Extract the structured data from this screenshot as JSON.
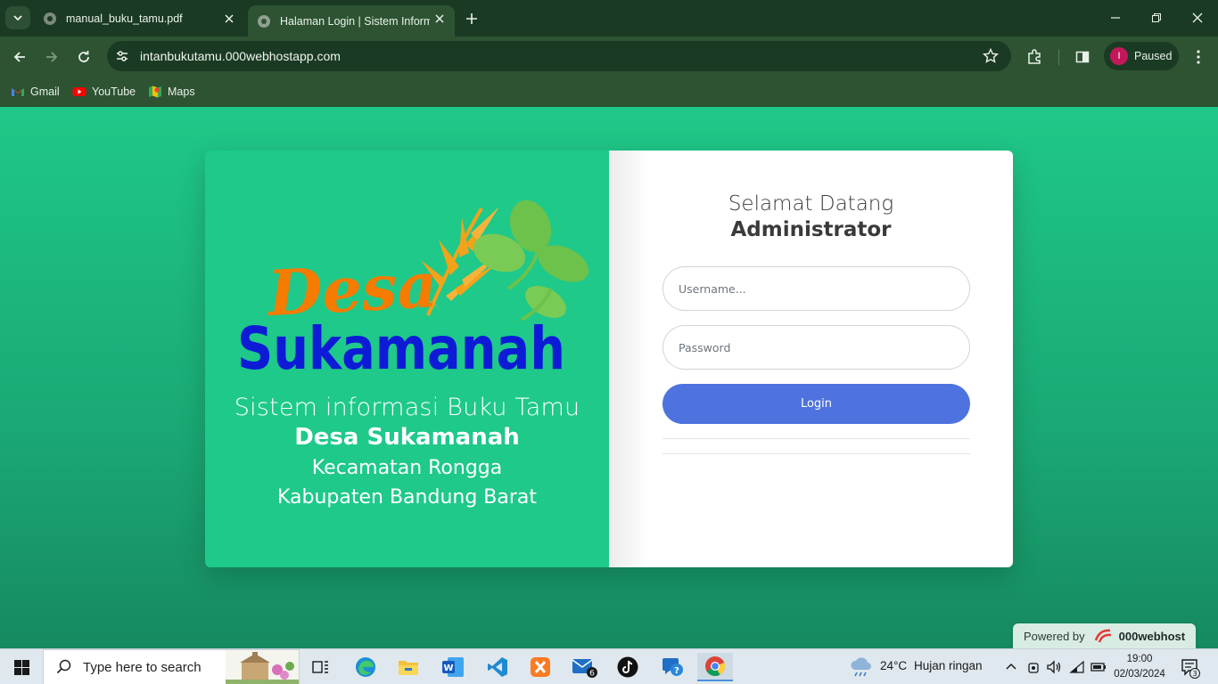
{
  "browser": {
    "tabs": [
      {
        "title": "manual_buku_tamu.pdf",
        "active": false
      },
      {
        "title": "Halaman Login | Sistem Informasi",
        "active": true
      }
    ],
    "url": "intanbukutamu.000webhostapp.com",
    "profile": {
      "initial": "I",
      "label": "Paused"
    },
    "bookmarks": [
      {
        "label": "Gmail",
        "icon": "gmail-icon"
      },
      {
        "label": "YouTube",
        "icon": "youtube-icon"
      },
      {
        "label": "Maps",
        "icon": "maps-icon"
      }
    ]
  },
  "logo": {
    "line1": "Desa",
    "line2": "Sukamanah"
  },
  "left_panel": {
    "line1": "Sistem informasi Buku Tamu",
    "line2": "Desa Sukamanah",
    "line3": "Kecamatan Rongga",
    "line4": "Kabupaten Bandung Barat"
  },
  "login_form": {
    "greeting": "Selamat Datang",
    "role": "Administrator",
    "username_placeholder": "Username...",
    "password_placeholder": "Password",
    "login_label": "Login"
  },
  "footer_badge": {
    "prefix": "Powered by",
    "brand": "000webhost"
  },
  "taskbar": {
    "search_placeholder": "Type here to search",
    "mail_badge": "6",
    "weather": {
      "temp": "24°C",
      "condition": "Hujan ringan"
    },
    "time": "19:00",
    "date": "02/03/2024",
    "notification_count": "3"
  },
  "colors": {
    "chrome_dark": "#1b3a23",
    "chrome_toolbar": "#2d5332",
    "page_green": "#1ec98a",
    "login_button": "#4e73df",
    "logo_orange": "#f57c00",
    "logo_blue": "#0d1bd6",
    "leaf_green": "#6cc24a"
  }
}
